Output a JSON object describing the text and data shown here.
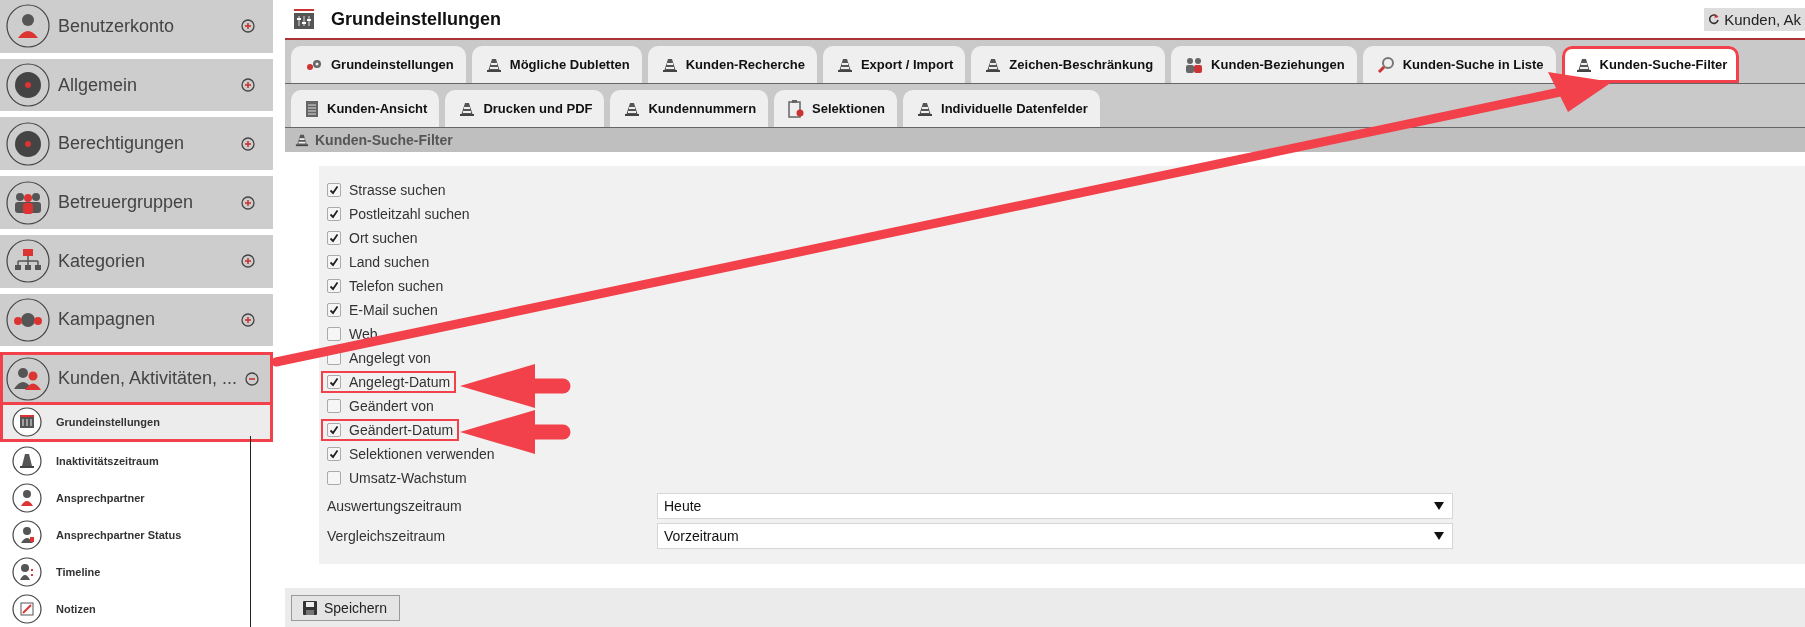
{
  "sidebar": {
    "items": [
      {
        "label": "Benutzerkonto",
        "expanded": false,
        "highlighted": false
      },
      {
        "label": "Allgemein",
        "expanded": false,
        "highlighted": false
      },
      {
        "label": "Berechtigungen",
        "expanded": false,
        "highlighted": false
      },
      {
        "label": "Betreuergruppen",
        "expanded": false,
        "highlighted": false
      },
      {
        "label": "Kategorien",
        "expanded": false,
        "highlighted": false
      },
      {
        "label": "Kampagnen",
        "expanded": false,
        "highlighted": false
      },
      {
        "label": "Kunden, Aktivitäten, ...",
        "expanded": true,
        "highlighted": true,
        "children": [
          {
            "label": "Grundeinstellungen",
            "selected": true
          },
          {
            "label": "Inaktivitätszeitraum",
            "selected": false
          },
          {
            "label": "Ansprechpartner",
            "selected": false
          },
          {
            "label": "Ansprechpartner Status",
            "selected": false
          },
          {
            "label": "Timeline",
            "selected": false
          },
          {
            "label": "Notizen",
            "selected": false
          }
        ]
      }
    ]
  },
  "header": {
    "title": "Grundeinstellungen",
    "context_button": "Kunden, Ak"
  },
  "tabs": [
    [
      {
        "label": "Grundeinstellungen",
        "selected": false,
        "highlighted": false
      },
      {
        "label": "Mögliche Dubletten",
        "selected": false,
        "highlighted": false
      },
      {
        "label": "Kunden-Recherche",
        "selected": false,
        "highlighted": false
      },
      {
        "label": "Export / Import",
        "selected": false,
        "highlighted": false
      },
      {
        "label": "Zeichen-Beschränkung",
        "selected": false,
        "highlighted": false
      },
      {
        "label": "Kunden-Beziehungen",
        "selected": false,
        "highlighted": false
      },
      {
        "label": "Kunden-Suche in Liste",
        "selected": false,
        "highlighted": false
      },
      {
        "label": "Kunden-Suche-Filter",
        "selected": true,
        "highlighted": true
      }
    ],
    [
      {
        "label": "Kunden-Ansicht",
        "selected": false,
        "highlighted": false
      },
      {
        "label": "Drucken und PDF",
        "selected": false,
        "highlighted": false
      },
      {
        "label": "Kundennummern",
        "selected": false,
        "highlighted": false
      },
      {
        "label": "Selektionen",
        "selected": false,
        "highlighted": false
      },
      {
        "label": "Individuelle Datenfelder",
        "selected": false,
        "highlighted": false
      }
    ]
  ],
  "section": {
    "title": "Kunden-Suche-Filter"
  },
  "options": [
    {
      "label": "Strasse suchen",
      "checked": true,
      "highlighted": false
    },
    {
      "label": "Postleitzahl suchen",
      "checked": true,
      "highlighted": false
    },
    {
      "label": "Ort suchen",
      "checked": true,
      "highlighted": false
    },
    {
      "label": "Land suchen",
      "checked": true,
      "highlighted": false
    },
    {
      "label": "Telefon suchen",
      "checked": true,
      "highlighted": false
    },
    {
      "label": "E-Mail suchen",
      "checked": true,
      "highlighted": false
    },
    {
      "label": "Web",
      "checked": false,
      "highlighted": false
    },
    {
      "label": "Angelegt von",
      "checked": false,
      "highlighted": false
    },
    {
      "label": "Angelegt-Datum",
      "checked": true,
      "highlighted": true
    },
    {
      "label": "Geändert von",
      "checked": false,
      "highlighted": false
    },
    {
      "label": "Geändert-Datum",
      "checked": true,
      "highlighted": true
    },
    {
      "label": "Selektionen verwenden",
      "checked": true,
      "highlighted": false
    },
    {
      "label": "Umsatz-Wachstum",
      "checked": false,
      "highlighted": false
    }
  ],
  "fields": [
    {
      "label": "Auswertungszeitraum",
      "value": "Heute"
    },
    {
      "label": "Vergleichszeitraum",
      "value": "Vorzeitraum"
    }
  ],
  "footer": {
    "save_button": "Speichern"
  }
}
